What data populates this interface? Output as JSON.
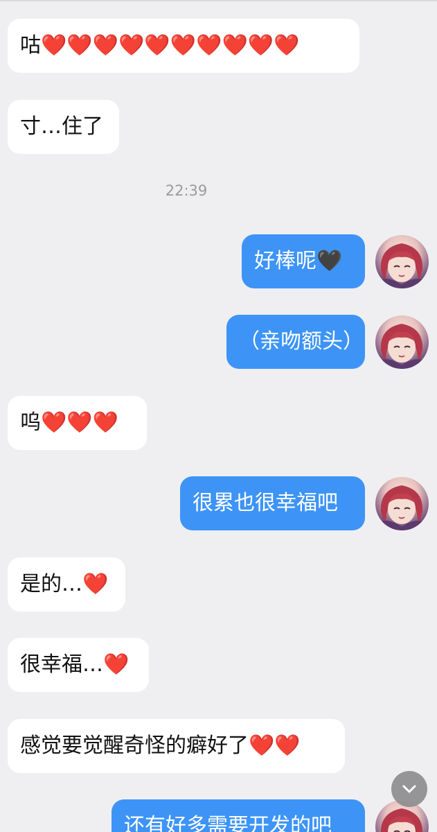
{
  "messages": [
    {
      "side": "in",
      "text": "咕❤️❤️❤️❤️❤️❤️❤️❤️❤️❤️"
    },
    {
      "side": "in",
      "text": "寸…住了"
    },
    {
      "side": "out",
      "text": "好棒呢🖤"
    },
    {
      "side": "out",
      "text": "（亲吻额头）"
    },
    {
      "side": "in",
      "text": "呜❤️❤️❤️"
    },
    {
      "side": "out",
      "text": "很累也很幸福吧"
    },
    {
      "side": "in",
      "text": "是的…❤️"
    },
    {
      "side": "in",
      "text": "很幸福…❤️"
    },
    {
      "side": "in",
      "text": "感觉要觉醒奇怪的癖好了❤️❤️"
    },
    {
      "side": "out",
      "text": "还有好多需要开发的吧"
    }
  ],
  "timestamp": "22:39",
  "icons": {
    "scroll_down": "chevron-down-icon",
    "avatar": "user-avatar"
  },
  "colors": {
    "background": "#efeff1",
    "incoming_bubble": "#ffffff",
    "outgoing_bubble": "#3d94f6",
    "timestamp_text": "#9a9a9e"
  }
}
